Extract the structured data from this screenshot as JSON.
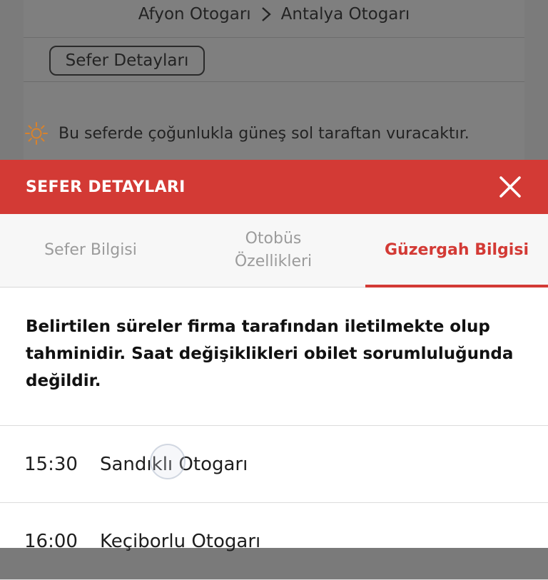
{
  "background": {
    "route": {
      "origin": "Afyon Otogarı",
      "destination": "Antalya Otogarı"
    },
    "details_button": "Sefer Detayları",
    "sun_notice": "Bu seferde çoğunlukla güneş sol taraftan vuracaktır."
  },
  "sheet": {
    "title": "SEFER DETAYLARI",
    "tabs": [
      {
        "label": "Sefer Bilgisi"
      },
      {
        "label_line1": "Otobüs",
        "label_line2": "Özellikleri"
      },
      {
        "label": "Güzergah Bilgisi"
      }
    ],
    "notice": "Belirtilen süreler firma tarafından iletilmekte olup tahminidir. Saat değişiklikleri obilet sorumluluğunda değildir.",
    "stops": [
      {
        "time": "15:30",
        "name": "Sandıklı Otogarı"
      },
      {
        "time": "16:00",
        "name": "Keçiborlu Otogarı"
      }
    ]
  },
  "colors": {
    "accent": "#d33a35",
    "overlay": "#7b7b7b",
    "sun": "#d9822b"
  }
}
